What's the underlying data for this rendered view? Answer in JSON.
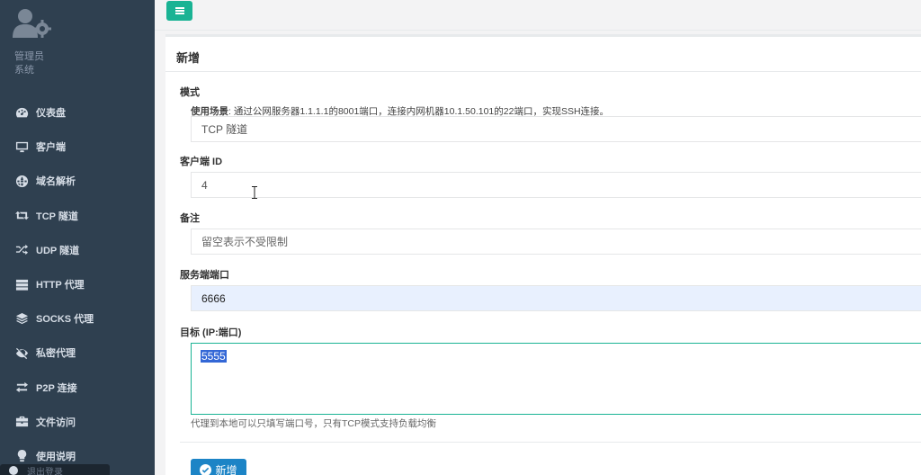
{
  "sidebar": {
    "role": "管理员",
    "system": "系统",
    "items": [
      {
        "label": "仪表盘",
        "icon": "dashboard-icon"
      },
      {
        "label": "客户端",
        "icon": "desktop-icon"
      },
      {
        "label": "域名解析",
        "icon": "globe-icon"
      },
      {
        "label": "TCP 隧道",
        "icon": "retweet-icon"
      },
      {
        "label": "UDP 隧道",
        "icon": "random-icon"
      },
      {
        "label": "HTTP 代理",
        "icon": "server-icon"
      },
      {
        "label": "SOCKS 代理",
        "icon": "layers-icon"
      },
      {
        "label": "私密代理",
        "icon": "eye-slash-icon"
      },
      {
        "label": "P2P 连接",
        "icon": "exchange-icon"
      },
      {
        "label": "文件访问",
        "icon": "briefcase-icon"
      },
      {
        "label": "使用说明",
        "icon": "lightbulb-icon"
      }
    ],
    "bottom_tip": "退出登录"
  },
  "panel": {
    "title": "新增"
  },
  "form": {
    "mode_label": "模式",
    "mode_hint_bold": "使用场景",
    "mode_hint_text": ": 通过公网服务器1.1.1.1的8001端口，连接内网机器10.1.50.101的22端口，实现SSH连接。",
    "mode_value": "TCP 隧道",
    "client_id_label": "客户端 ID",
    "client_id_value": "4",
    "remark_label": "备注",
    "remark_placeholder": "留空表示不受限制",
    "server_port_label": "服务端端口",
    "server_port_value": "6666",
    "target_label": "目标 (IP:端口)",
    "target_value": "5555",
    "target_help": "代理到本地可以只填写端口号，只有TCP模式支持负载均衡",
    "submit_label": "新增"
  },
  "colors": {
    "sidebar_bg": "#2f4050",
    "accent_green": "#1ab394",
    "primary_blue": "#1c84c6",
    "autofill_bg": "#e8f0fe"
  }
}
